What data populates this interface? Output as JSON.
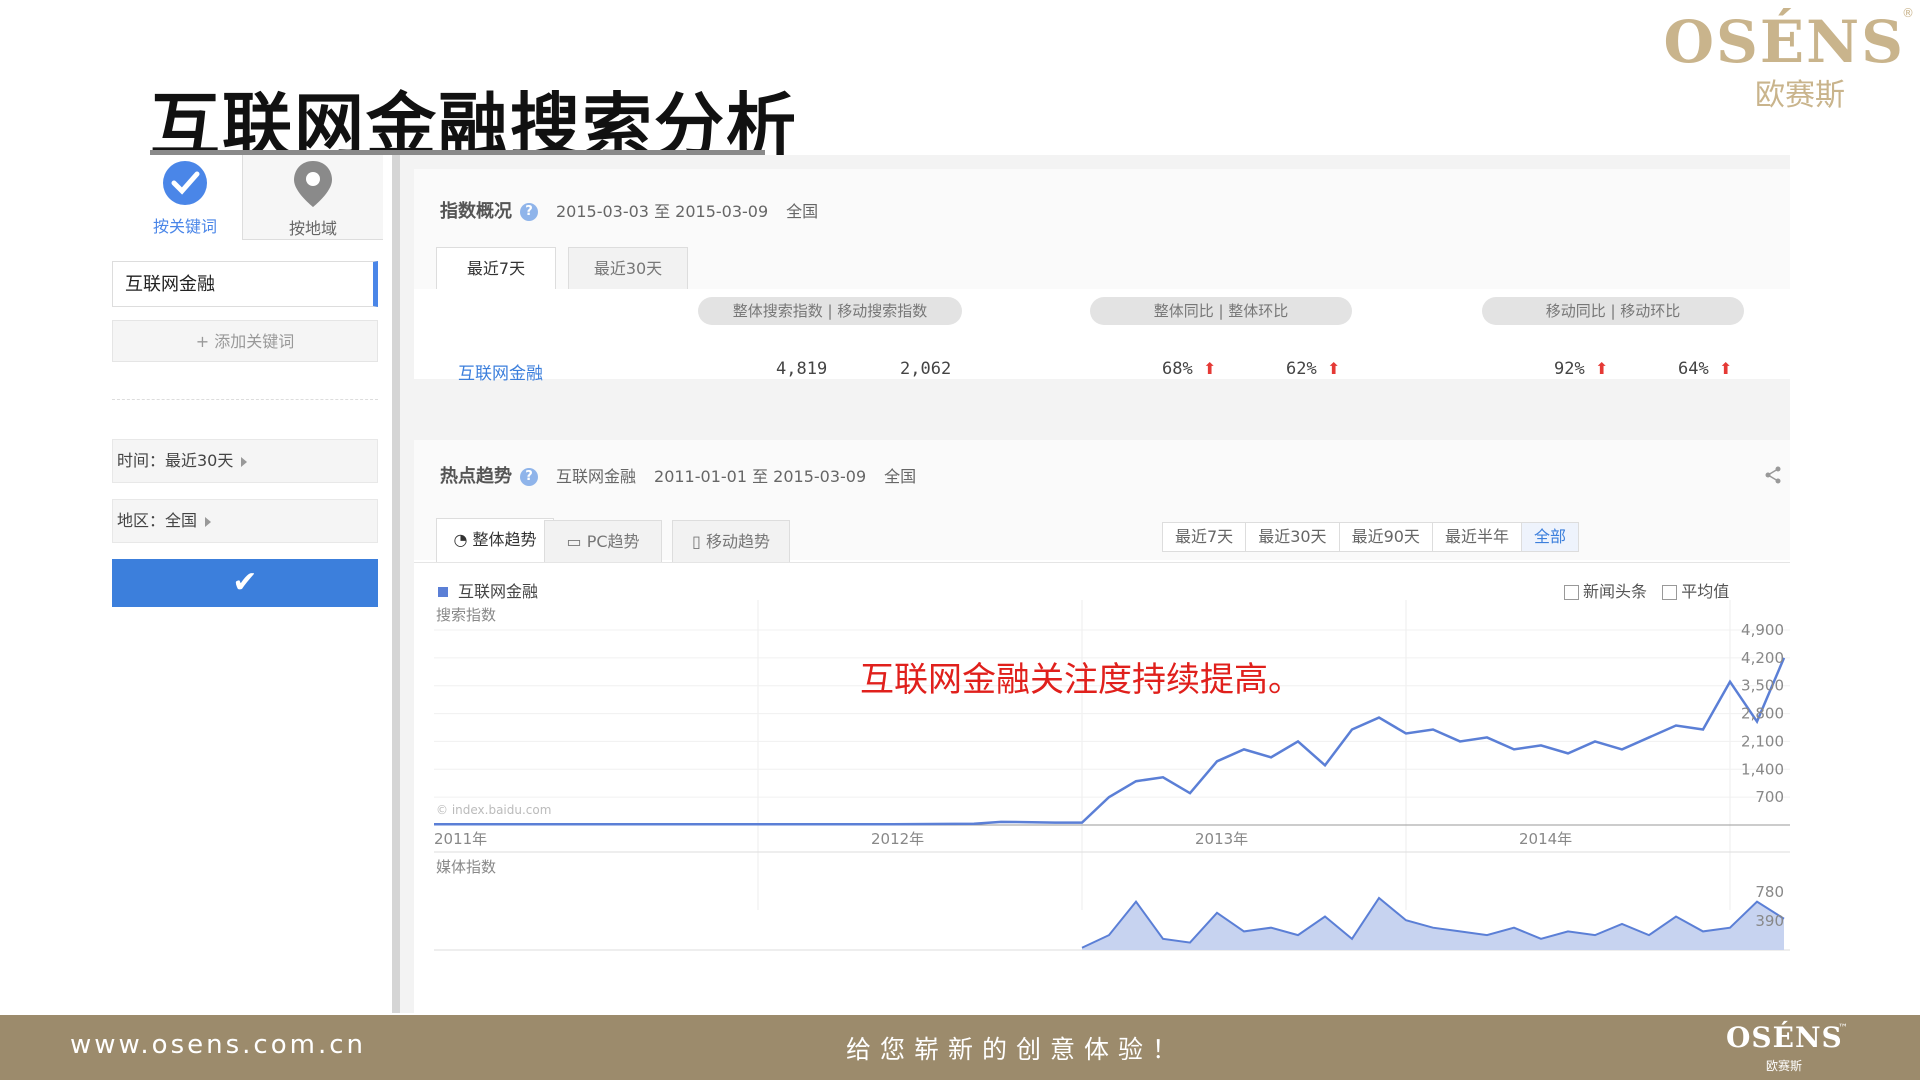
{
  "slide": {
    "title": "互联网金融搜索分析",
    "logo_word": "OSÉNS",
    "logo_reg": "®",
    "logo_cn": "欧赛斯",
    "annotation": "互联网金融关注度持续提高。",
    "footer": {
      "url": "www.osens.com.cn",
      "slogan": "给您崭新的创意体验！",
      "logo_word": "OSÉNS",
      "logo_tm": "™",
      "logo_cn": "欧赛斯"
    }
  },
  "sidebar": {
    "mode_tabs": [
      {
        "label": "按关键词",
        "icon": "check-circle-icon",
        "active": true
      },
      {
        "label": "按地域",
        "icon": "map-pin-icon",
        "active": false
      }
    ],
    "keyword": "互联网金融",
    "add_keyword": "添加关键词",
    "filters": {
      "time": "时间：最近30天",
      "region": "地区：全国"
    },
    "accent": "#3c7fdc"
  },
  "overview": {
    "title": "指数概况",
    "date_range": "2015-03-03 至 2015-03-09",
    "region": "全国",
    "tabs": [
      "最近7天",
      "最近30天"
    ],
    "headers": {
      "search": [
        "整体搜索指数",
        "移动搜索指数"
      ],
      "overall": [
        "整体同比",
        "整体环比"
      ],
      "mobile": [
        "移动同比",
        "移动环比"
      ]
    },
    "row": {
      "keyword": "互联网金融",
      "overall_index": "4,819",
      "mobile_index": "2,062",
      "overall_yoy": "68%",
      "overall_mom": "62%",
      "mobile_yoy": "92%",
      "mobile_mom": "64%"
    }
  },
  "trend": {
    "title": "热点趋势",
    "keyword": "互联网金融",
    "date_range": "2011-01-01 至 2015-03-09",
    "region": "全国",
    "tabs": [
      "整体趋势",
      "PC趋势",
      "移动趋势"
    ],
    "ranges": [
      "最近7天",
      "最近30天",
      "最近90天",
      "最近半年",
      "全部"
    ],
    "active_range": "全部",
    "legend": "互联网金融",
    "options": [
      "新闻头条",
      "平均值"
    ],
    "watermark": "© index.baidu.com",
    "series_color": "#5b7fd6"
  },
  "chart_data": [
    {
      "type": "line",
      "ylabel": "搜索指数",
      "x_ticks": [
        "2011年",
        "2012年",
        "2013年",
        "2014年"
      ],
      "y_ticks": [
        "700",
        "1,400",
        "2,100",
        "2,800",
        "3,500",
        "4,200",
        "4,900"
      ],
      "ylim": [
        0,
        4900
      ],
      "series": [
        {
          "name": "互联网金融",
          "x": [
            "2011-01",
            "2011-06",
            "2012-01",
            "2012-06",
            "2012-09",
            "2012-10",
            "2012-12",
            "2013-01",
            "2013-02",
            "2013-03",
            "2013-04",
            "2013-05",
            "2013-06",
            "2013-07",
            "2013-08",
            "2013-09",
            "2013-10",
            "2013-11",
            "2013-12",
            "2014-01",
            "2014-02",
            "2014-03",
            "2014-04",
            "2014-05",
            "2014-06",
            "2014-07",
            "2014-08",
            "2014-09",
            "2014-10",
            "2014-11",
            "2014-12",
            "2015-01",
            "2015-02",
            "2015-03"
          ],
          "values": [
            20,
            20,
            20,
            20,
            30,
            80,
            60,
            60,
            700,
            1100,
            1200,
            800,
            1600,
            1900,
            1700,
            2100,
            1500,
            2400,
            2700,
            2300,
            2400,
            2100,
            2200,
            1900,
            2000,
            1800,
            2100,
            1900,
            2200,
            2500,
            2400,
            3600,
            2600,
            4200
          ]
        }
      ]
    },
    {
      "type": "area",
      "ylabel": "媒体指数",
      "y_ticks": [
        "390",
        "780"
      ],
      "ylim": [
        0,
        780
      ],
      "series": [
        {
          "name": "互联网金融",
          "x": [
            "2013-01",
            "2013-02",
            "2013-03",
            "2013-04",
            "2013-05",
            "2013-06",
            "2013-07",
            "2013-08",
            "2013-09",
            "2013-10",
            "2013-11",
            "2013-12",
            "2014-01",
            "2014-02",
            "2014-03",
            "2014-04",
            "2014-05",
            "2014-06",
            "2014-07",
            "2014-08",
            "2014-09",
            "2014-10",
            "2014-11",
            "2014-12",
            "2015-01",
            "2015-02",
            "2015-03"
          ],
          "values": [
            30,
            200,
            650,
            150,
            100,
            500,
            250,
            300,
            200,
            450,
            150,
            700,
            400,
            300,
            250,
            200,
            300,
            150,
            250,
            200,
            350,
            200,
            450,
            250,
            300,
            650,
            420
          ]
        }
      ]
    }
  ]
}
